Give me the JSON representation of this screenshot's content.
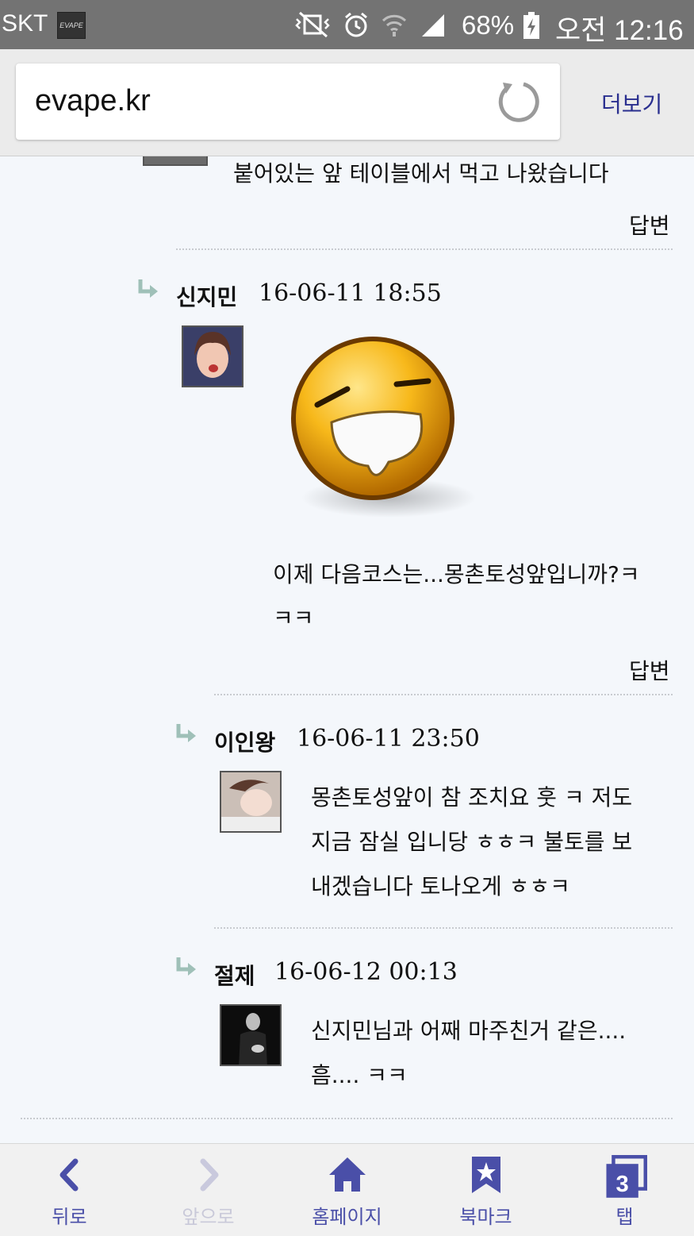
{
  "status_bar": {
    "carrier": "SKT",
    "app_icon_text": "EVAPE",
    "battery": "68%",
    "time": "오전 12:16"
  },
  "browser": {
    "url": "evape.kr",
    "more_label": "더보기"
  },
  "comments": {
    "partial_line": "붙어있는 앞 테이블에서 먹고 나왔습니다",
    "reply_label": "답변",
    "items": [
      {
        "author": "신지민",
        "date": "16-06-11 18:55",
        "lines": [
          "이제 다음코스는...몽촌토성앞입니까?ㅋ",
          "ㅋㅋ"
        ]
      },
      {
        "author": "이인왕",
        "date": "16-06-11 23:50",
        "lines": [
          "몽촌토성앞이 참 조치요 훗 ㅋ 저도",
          "지금 잠실 입니당 ㅎㅎㅋ 불토를 보",
          "내겠습니다 토나오게 ㅎㅎㅋ"
        ]
      },
      {
        "author": "절제",
        "date": "16-06-12 00:13",
        "lines": [
          "신지민님과 어째 마주친거 같은....",
          "흠.... ㅋㅋ"
        ]
      }
    ]
  },
  "bottom_nav": {
    "back": "뒤로",
    "forward": "앞으로",
    "home": "홈페이지",
    "bookmark": "북마크",
    "tabs": "탭",
    "tab_count": "3"
  },
  "colors": {
    "accent": "#4a4fa8",
    "status_bar": "#737373",
    "background": "#f4f7fb"
  }
}
